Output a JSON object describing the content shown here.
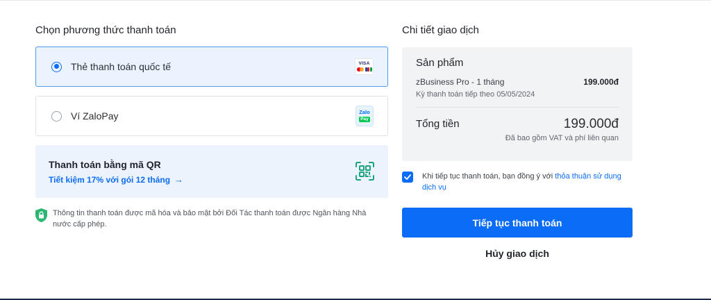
{
  "payment_methods": {
    "title": "Chọn phương thức thanh toán",
    "options": [
      {
        "label": "Thẻ thanh toán quốc tế",
        "selected": true,
        "logo": "visa-mastercard-jcb-icon"
      },
      {
        "label": "Ví ZaloPay",
        "selected": false,
        "logo": "zalopay-icon"
      }
    ],
    "card_logo_text": "VISA",
    "zalo_logo_text": {
      "top": "Zalo",
      "bottom": "Pay"
    },
    "qr": {
      "title": "Thanh toán bằng mã QR",
      "promo": "Tiết kiệm 17% với gói 12 tháng",
      "promo_arrow": "→",
      "icon": "qr-scan-icon"
    },
    "security_note": "Thông tin thanh toán được mã hóa và bảo mật bởi Đối Tác thanh toán được Ngân hàng Nhà nước cấp phép."
  },
  "transaction": {
    "title": "Chi tiết giao dịch",
    "product_heading": "Sản phẩm",
    "product_name": "zBusiness Pro - 1 tháng",
    "product_price": "199.000đ",
    "next_billing": "Kỳ thanh toán tiếp theo 05/05/2024",
    "total_label": "Tổng tiền",
    "total_amount": "199.000đ",
    "vat_note": "Đã bao gồm VAT và phí liên quan",
    "agreement": {
      "checked": true,
      "text": "Khi tiếp tục thanh toán, bạn đồng ý với ",
      "link": "thỏa thuận sử dụng dịch vụ"
    },
    "continue_button": "Tiếp tục thanh toán",
    "cancel_button": "Hủy giao dịch"
  },
  "colors": {
    "accent": "#0b6cf5",
    "selected_bg": "#eaf3fe",
    "summary_bg": "#f1f3f5",
    "qr_bg": "#ecf3fc",
    "shield": "#2bb673",
    "qr_icon": "#1aa37a"
  }
}
